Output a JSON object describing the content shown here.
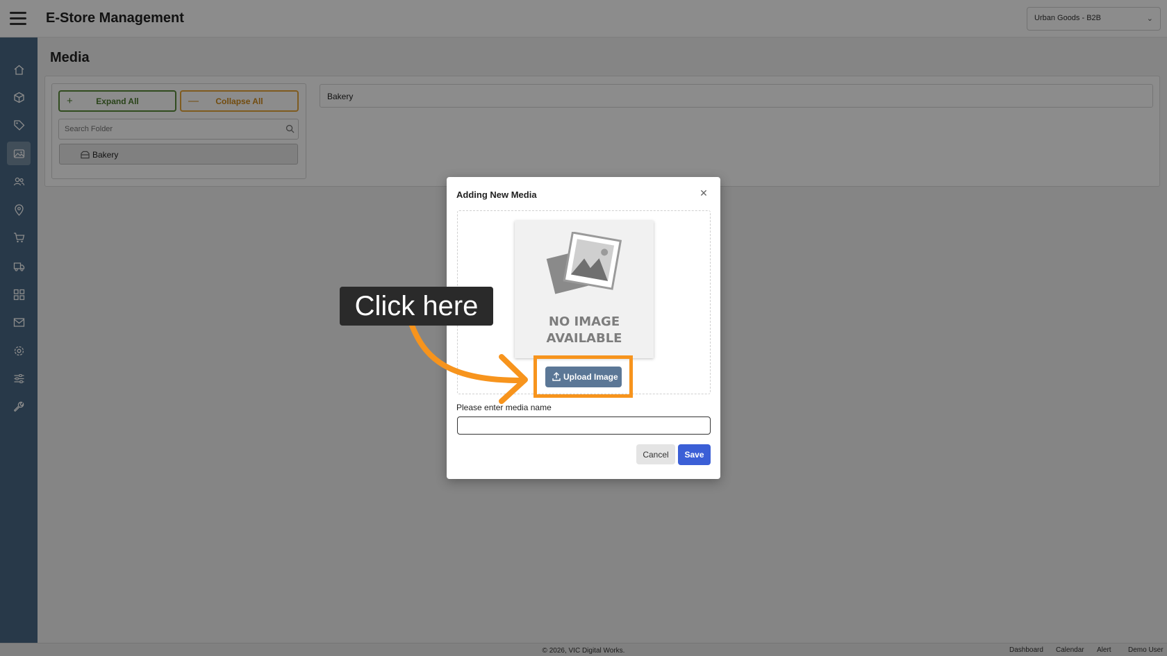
{
  "header": {
    "app_title": "E-Store Management",
    "store_selector": "Urban Goods - B2B"
  },
  "sidebar": {
    "items": [
      {
        "icon": "home-icon"
      },
      {
        "icon": "box-icon"
      },
      {
        "icon": "tag-icon"
      },
      {
        "icon": "image-icon",
        "active": true
      },
      {
        "icon": "users-icon"
      },
      {
        "icon": "location-pin-icon"
      },
      {
        "icon": "cart-icon"
      },
      {
        "icon": "truck-icon"
      },
      {
        "icon": "grid-icon"
      },
      {
        "icon": "mail-icon"
      },
      {
        "icon": "gear-icon"
      },
      {
        "icon": "sliders-icon"
      },
      {
        "icon": "wrench-icon"
      }
    ]
  },
  "main": {
    "page_title": "Media",
    "expand_all": "Expand All",
    "collapse_all": "Collapse All",
    "search_placeholder": "Search Folder",
    "folders": [
      "Bakery"
    ],
    "breadcrumb": "Bakery"
  },
  "modal": {
    "title": "Adding New Media",
    "placeholder_line1": "NO IMAGE",
    "placeholder_line2": "AVAILABLE",
    "upload_button": "Upload Image",
    "name_label": "Please enter media name",
    "name_value": "",
    "cancel": "Cancel",
    "save": "Save"
  },
  "tutorial": {
    "callout": "Click here",
    "accent_color": "#f7941d"
  },
  "footer": {
    "copyright": "© 2026, VIC Digital Works.",
    "links": [
      "Dashboard",
      "Calendar",
      "Alert",
      "Demo User"
    ]
  },
  "colors": {
    "sidebar": "#4a6985",
    "primary": "#3b5fd6",
    "expand_green": "#5a8a3a",
    "collapse_orange": "#e7a63a"
  }
}
